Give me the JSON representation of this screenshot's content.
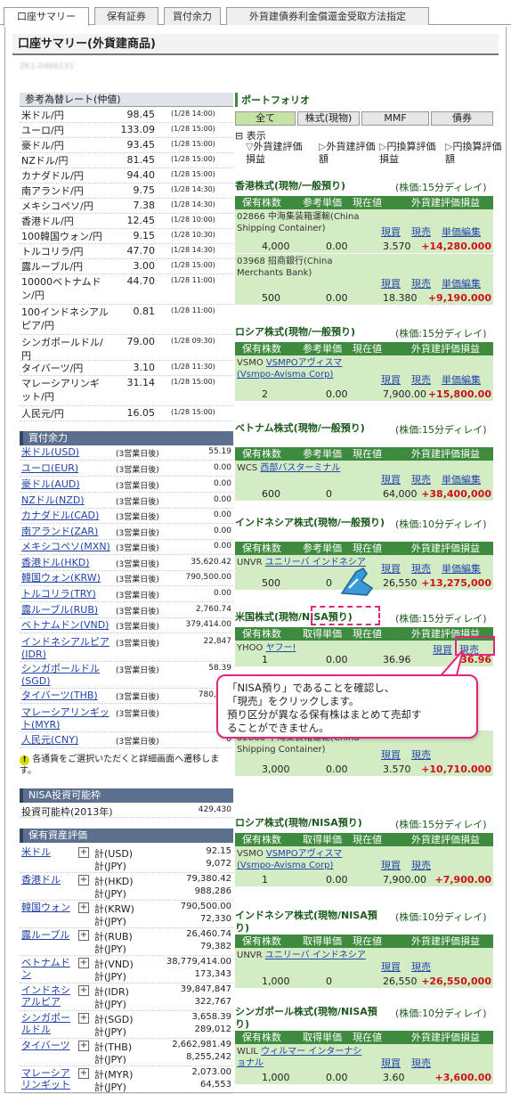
{
  "tabs": [
    "口座サマリー",
    "保有証券",
    "買付余力",
    "外貨建債券利金償還金受取方法指定"
  ],
  "page_title": "口座サマリー(外貨建商品)",
  "account_no": "ZK1-0466131",
  "rates": {
    "title": "参考為替レート(仲値)",
    "items": [
      [
        "米ドル/円",
        "98.45",
        "(1/28 14:00)"
      ],
      [
        "ユーロ/円",
        "133.09",
        "(1/28 15:00)"
      ],
      [
        "豪ドル/円",
        "93.45",
        "(1/28 15:00)"
      ],
      [
        "NZドル/円",
        "81.45",
        "(1/28 15:00)"
      ],
      [
        "カナダドル/円",
        "94.40",
        "(1/28 15:00)"
      ],
      [
        "南アランド/円",
        "9.75",
        "(1/28 14:30)"
      ],
      [
        "メキシコペソ/円",
        "7.38",
        "(1/28 14:30)"
      ],
      [
        "香港ドル/円",
        "12.45",
        "(1/28 10:00)"
      ],
      [
        "100韓国ウォン/円",
        "9.15",
        "(1/28 10:30)"
      ],
      [
        "トルコリラ/円",
        "47.70",
        "(1/28 14:30)"
      ],
      [
        "露ルーブル/円",
        "3.00",
        "(1/28 15:00)"
      ],
      [
        "10000ベトナムドン/円",
        "44.70",
        "(1/28 11:00)"
      ],
      [
        "100インドネシアルピア/円",
        "0.81",
        "(1/28 11:00)"
      ],
      [
        "シンガポールドル/円",
        "79.00",
        "(1/28 09:30)"
      ],
      [
        "タイバーツ/円",
        "3.10",
        "(1/28 11:30)"
      ],
      [
        "マレーシアリンギット/円",
        "31.14",
        "(1/28 15:00)"
      ],
      [
        "人民元/円",
        "16.05",
        "(1/28 15:00)"
      ]
    ]
  },
  "buying": {
    "title": "買付余力",
    "items": [
      [
        "米ドル(USD)",
        "(3営業日後)",
        "55.19"
      ],
      [
        "ユーロ(EUR)",
        "(3営業日後)",
        "0.00"
      ],
      [
        "豪ドル(AUD)",
        "(3営業日後)",
        "0.00"
      ],
      [
        "NZドル(NZD)",
        "(3営業日後)",
        "0.00"
      ],
      [
        "カナダドル(CAD)",
        "(3営業日後)",
        "0.00"
      ],
      [
        "南アランド(ZAR)",
        "(3営業日後)",
        "0.00"
      ],
      [
        "メキシコペソ(MXN)",
        "(3営業日後)",
        "0.00"
      ],
      [
        "香港ドル(HKD)",
        "(3営業日後)",
        "35,620.42"
      ],
      [
        "韓国ウォン(KRW)",
        "(3営業日後)",
        "790,500.00"
      ],
      [
        "トルコリラ(TRY)",
        "(3営業日後)",
        "0.00"
      ],
      [
        "露ルーブル(RUB)",
        "(3営業日後)",
        "2,760.74"
      ],
      [
        "ベトナムドン(VND)",
        "(3営業日後)",
        "379,414.00"
      ],
      [
        "インドネシアルピア(IDR)",
        "(3営業日後)",
        "22,847"
      ],
      [
        "シンガポールドル(SGD)",
        "(3営業日後)",
        "58.39"
      ],
      [
        "タイバーツ(THB)",
        "(3営業日後)",
        "780,481"
      ],
      [
        "マレーシアリンギット(MYR)",
        "(3営業日後)",
        "237"
      ],
      [
        "人民元(CNY)",
        "(3営業日後)",
        "0"
      ]
    ],
    "note": "各通貨をご選択いただくと詳細画面へ遷移します。"
  },
  "nisa": {
    "title": "NISA投資可能枠",
    "label": "投資可能枠(2013年)",
    "value": "429,430"
  },
  "holdings": {
    "title": "保有資産評価",
    "items": [
      [
        "米ドル",
        "計(USD)",
        "92.15",
        "計(JPY)",
        "9,072"
      ],
      [
        "香港ドル",
        "計(HKD)",
        "79,380.42",
        "計(JPY)",
        "988,286"
      ],
      [
        "韓国ウォン",
        "計(KRW)",
        "790,500.00",
        "計(JPY)",
        "72,330"
      ],
      [
        "露ルーブル",
        "計(RUB)",
        "26,460.74",
        "計(JPY)",
        "79,382"
      ],
      [
        "ベトナムドン",
        "計(VND)",
        "38,779,414.00",
        "計(JPY)",
        "173,343"
      ],
      [
        "インドネシアルピア",
        "計(IDR)",
        "39,847,847",
        "計(JPY)",
        "322,767"
      ],
      [
        "シンガポールドル",
        "計(SGD)",
        "3,658.39",
        "計(JPY)",
        "289,012"
      ],
      [
        "タイバーツ",
        "計(THB)",
        "2,662,981.49",
        "計(JPY)",
        "8,255,242"
      ],
      [
        "マレーシアリンギット",
        "計(MYR)",
        "2,073.00",
        "計(JPY)",
        "64,553"
      ]
    ]
  },
  "portfolio": {
    "title": "ポートフォリオ",
    "tabs": [
      "全て",
      "株式(現物)",
      "MMF",
      "債券"
    ],
    "display_label": "表示",
    "sorts": [
      "外貨建評価損益",
      "外貨建評価額",
      "円換算評価損益",
      "円換算評価額"
    ]
  },
  "sections": [
    {
      "title": "香港株式(現物/一般預り)",
      "delay": "(株価:15分ディレイ)",
      "cols": [
        "保有株数",
        "参考単価",
        "現在値",
        "外貨建評価損益"
      ],
      "rows": [
        {
          "code": "02866",
          "name": "中海集装箱運輸(China Shipping Container)",
          "qty": "4,000",
          "cost": "0.00",
          "price": "3.570",
          "pl": "+14,280.000",
          "a": [
            "現買",
            "現売",
            "単価編集"
          ]
        },
        {
          "code": "03968",
          "name": "招商銀行(China Merchants Bank)",
          "qty": "500",
          "cost": "0.00",
          "price": "18.380",
          "pl": "+9,190.000",
          "a": [
            "現買",
            "現売",
            "単価編集"
          ]
        }
      ]
    },
    {
      "title": "ロシア株式(現物/一般預り)",
      "delay": "(株価:15分ディレイ)",
      "cols": [
        "保有株数",
        "参考単価",
        "現在値",
        "外貨建評価損益"
      ],
      "rows": [
        {
          "code": "VSMO",
          "name": "VSMPOアヴィスマ(Vsmpo-Avisma Corp)",
          "qty": "2",
          "cost": "0.00",
          "price": "7,900.00",
          "pl": "+15,800.00",
          "a": [
            "現買",
            "現売",
            "単価編集"
          ]
        }
      ]
    },
    {
      "title": "ベトナム株式(現物/一般預り)",
      "delay": "(株価:15分ディレイ)",
      "cols": [
        "保有株数",
        "参考単価",
        "現在値",
        "外貨建評価損益"
      ],
      "rows": [
        {
          "code": "WCS",
          "name": "西部バスターミナル",
          "qty": "600",
          "cost": "0",
          "price": "64,000",
          "pl": "+38,400,000",
          "a": [
            "現買",
            "現売",
            "単価編集"
          ]
        }
      ]
    },
    {
      "title": "インドネシア株式(現物/一般預り)",
      "delay": "(株価:10分ディレイ)",
      "cols": [
        "保有株数",
        "参考単価",
        "現在値",
        "外貨建評価損益"
      ],
      "rows": [
        {
          "code": "UNVR",
          "name": "ユニリーバ インドネシア",
          "qty": "500",
          "cost": "0",
          "price": "26,550",
          "pl": "+13,275,000",
          "a": [
            "現買",
            "現売",
            "単価編集"
          ]
        }
      ]
    },
    {
      "title": "米国株式(現物/NISA預り)",
      "delay": "(株価:15分ディレイ)",
      "cols": [
        "保有株数",
        "取得単価",
        "現在値",
        "外貨建評価損益"
      ],
      "rows": [
        {
          "code": "YHOO",
          "name": "ヤフー!",
          "qty": "1",
          "cost": "0.00",
          "price": "36.96",
          "pl": "+36.96",
          "a": [
            "現買",
            "現売"
          ]
        }
      ]
    },
    {
      "title": "",
      "delay": "",
      "cols": [],
      "rows": [
        {
          "code": "02866",
          "name": "中海集装箱運輸(China Shipping Container)",
          "qty": "3,000",
          "cost": "0.00",
          "price": "3.570",
          "pl": "+10,710.000",
          "a": [
            "現買",
            "現売"
          ]
        }
      ]
    },
    {
      "title": "ロシア株式(現物/NISA預り)",
      "delay": "(株価:15分ディレイ)",
      "cols": [
        "保有株数",
        "取得単価",
        "現在値",
        "外貨建評価損益"
      ],
      "rows": [
        {
          "code": "VSMO",
          "name": "VSMPOアヴィスマ(Vsmpo-Avisma Corp)",
          "qty": "1",
          "cost": "0.00",
          "price": "7,900.00",
          "pl": "+7,900.00",
          "a": [
            "現買",
            "現売"
          ]
        }
      ]
    },
    {
      "title": "インドネシア株式(現物/NISA預り)",
      "delay": "(株価:10分ディレイ)",
      "cols": [
        "保有株数",
        "取得単価",
        "現在値",
        "外貨建評価損益"
      ],
      "rows": [
        {
          "code": "UNVR",
          "name": "ユニリーバ インドネシア",
          "qty": "1,000",
          "cost": "0",
          "price": "26,550",
          "pl": "+26,550,000",
          "a": [
            "現買",
            "現売"
          ]
        }
      ]
    },
    {
      "title": "シンガポール株式(現物/NISA預り)",
      "delay": "(株価:10分ディレイ)",
      "cols": [
        "保有株数",
        "取得単価",
        "現在値",
        "外貨建評価損益"
      ],
      "rows": [
        {
          "code": "WLIL",
          "name": "ウィルマー インターナショナル",
          "qty": "1,000",
          "cost": "0.00",
          "price": "3.60",
          "pl": "+3,600.00",
          "a": [
            "現買",
            "現売"
          ]
        }
      ]
    }
  ],
  "callout": [
    "「NISA預り」であることを確認し、",
    "「現売」をクリックします。",
    "預り区分が異なる保有株はまとめて売却す",
    "ることができません。"
  ],
  "colors": {
    "green": "#3e8a3e",
    "pale_green": "#d4ecc4",
    "navy": "#5b6f8f",
    "red": "#d0101b",
    "pink": "#e0267a"
  }
}
